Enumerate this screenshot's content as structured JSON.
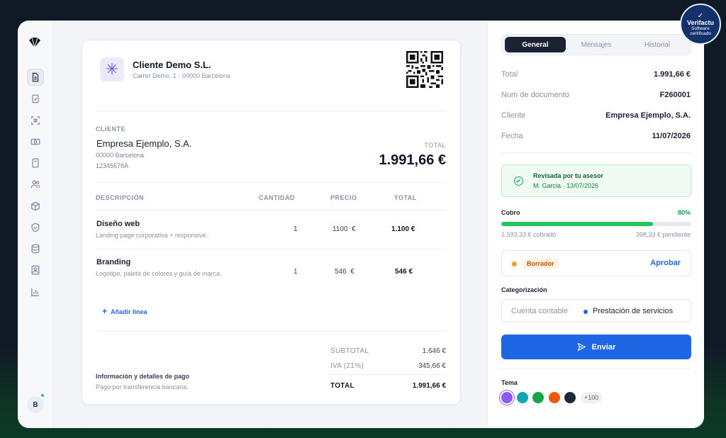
{
  "colors": {
    "accent": "#1f66e5",
    "success": "#22c55e",
    "warning": "#f59e0b",
    "sidebar_bg": "#f7f8fa"
  },
  "sidebar": {
    "items": [
      {
        "icon": "document-icon",
        "active": true
      },
      {
        "icon": "clipboard-check-icon"
      },
      {
        "icon": "scan-icon"
      },
      {
        "icon": "banknote-icon"
      },
      {
        "icon": "calculator-icon"
      },
      {
        "icon": "users-icon"
      },
      {
        "icon": "box-icon"
      },
      {
        "icon": "shield-check-icon"
      },
      {
        "icon": "database-icon"
      },
      {
        "icon": "contact-card-icon"
      },
      {
        "icon": "bar-chart-icon"
      }
    ],
    "avatar_initial": "B"
  },
  "invoice": {
    "company": {
      "name": "Cliente Demo S.L.",
      "address": "Carrer Demo, 1 · 00000 Barcelona"
    },
    "client_label": "CLIENTE",
    "client": {
      "name": "Empresa Ejemplo, S.A.",
      "city": "00000 Barcelona",
      "nif": "12345678A"
    },
    "total_label": "TOTAL",
    "total": "1.991,66 €",
    "columns": [
      "DESCRIPCIÓN",
      "CANTIDAD",
      "PRECIO",
      "TOTAL"
    ],
    "lines": [
      {
        "name": "Diseño web",
        "desc": "Landing page corporativa + responsive.",
        "qty": "1",
        "price": "1100  €",
        "total": "1.100 €"
      },
      {
        "name": "Branding",
        "desc": "Logotipo, paleta de colores y guía de marca.",
        "qty": "1",
        "price": "546  €",
        "total": "546 €"
      }
    ],
    "add_line": "Añadir línea",
    "payment": {
      "title": "Información y detalles de pago",
      "desc": "Pago por transferencia bancaria."
    },
    "summary": {
      "subtotal_label": "SUBTOTAL",
      "subtotal": "1.646 €",
      "iva_label": "IVA (21%)",
      "iva": "345,66 €",
      "total_label": "TOTAL",
      "total": "1.991,66 €"
    }
  },
  "panel": {
    "tabs": [
      "General",
      "Mensajes",
      "Historial"
    ],
    "details": [
      {
        "label": "Total",
        "value": "1.991,66 €"
      },
      {
        "label": "Num de documento",
        "value": "F260001"
      },
      {
        "label": "Cliente",
        "value": "Empresa Ejemplo, S.A."
      },
      {
        "label": "Fecha",
        "value": "11/07/2026"
      }
    ],
    "review": {
      "title": "Revisada por tu asesor",
      "sub": "M. Garcia · 13/07/2026"
    },
    "cobro": {
      "label": "Cobro",
      "percent_text": "80%",
      "percent": 80,
      "collected": "1.593,33 € cobrado",
      "pending": "398,33 € pendiente"
    },
    "status": {
      "badge": "Borrador",
      "action": "Aprobar"
    },
    "categorization": {
      "title": "Categorización",
      "account": "Cuenta contable",
      "category": "Prestación de servicios"
    },
    "send_label": "Enviar",
    "theme": {
      "title": "Tema",
      "swatches": [
        "#8b5cf6",
        "#0ea5b7",
        "#16a34a",
        "#ea580c",
        "#1e293b"
      ],
      "more": "+100"
    }
  },
  "badge": {
    "title": "Verifactu",
    "line1": "Software",
    "line2": "certificado"
  }
}
